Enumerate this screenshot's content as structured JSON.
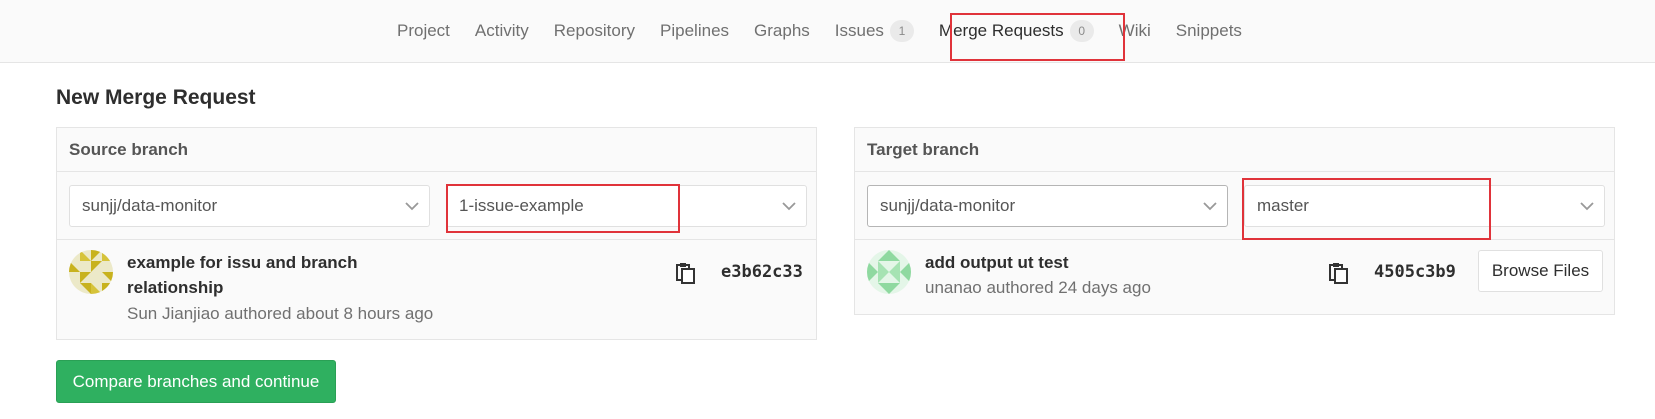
{
  "nav": {
    "items": [
      {
        "label": "Project"
      },
      {
        "label": "Activity"
      },
      {
        "label": "Repository"
      },
      {
        "label": "Pipelines"
      },
      {
        "label": "Graphs"
      },
      {
        "label": "Issues",
        "badge": "1"
      },
      {
        "label": "Merge Requests",
        "badge": "0"
      },
      {
        "label": "Wiki"
      },
      {
        "label": "Snippets"
      }
    ]
  },
  "page": {
    "title": "New Merge Request"
  },
  "source": {
    "header": "Source branch",
    "project": "sunjj/data-monitor",
    "branch": "1-issue-example",
    "commit": {
      "title_line1": "example for issu and branch",
      "title_line2": "relationship",
      "meta": "Sun Jianjiao authored about 8 hours ago",
      "sha": "e3b62c33"
    }
  },
  "target": {
    "header": "Target branch",
    "project": "sunjj/data-monitor",
    "branch": "master",
    "commit": {
      "title": "add output ut test",
      "meta": "unanao authored 24 days ago",
      "sha": "4505c3b9"
    },
    "browse_label": "Browse Files"
  },
  "actions": {
    "compare_label": "Compare branches and continue"
  },
  "colors": {
    "accent_green": "#2fb060",
    "highlight_red": "#e0333a",
    "avatar_gold": "#c8b21e",
    "avatar_green": "#8fd9a0"
  },
  "icons": {
    "chevron": "chevron-down-icon",
    "copy": "clipboard-icon"
  }
}
